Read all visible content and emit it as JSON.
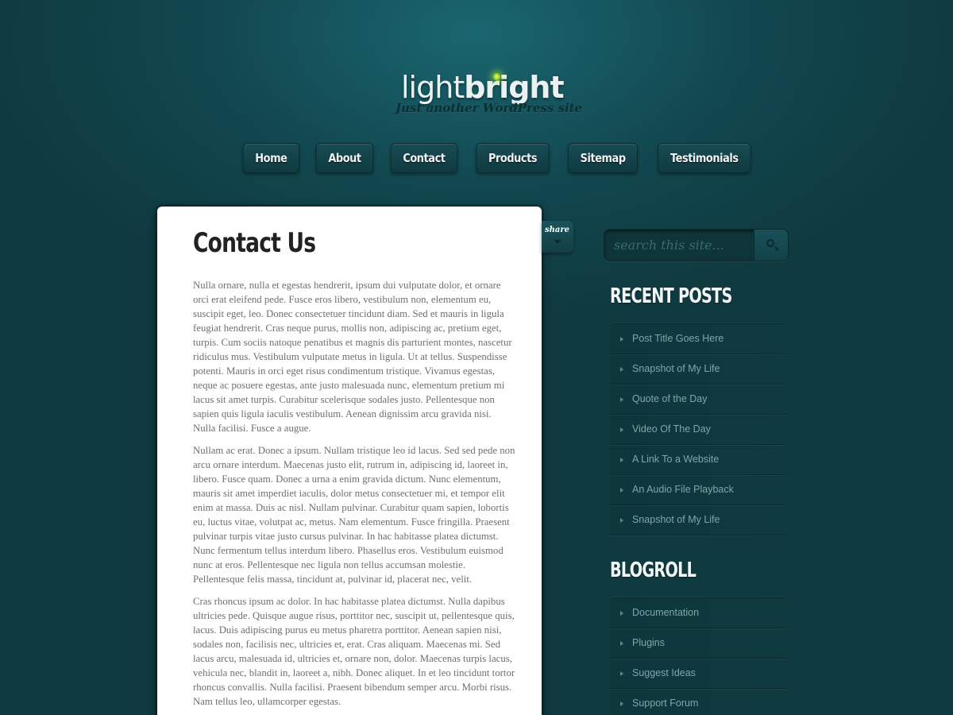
{
  "site": {
    "logo_light": "light",
    "logo_bright": "bright",
    "tagline": "Just another WordPress site"
  },
  "nav": [
    {
      "label": "Home"
    },
    {
      "label": "About"
    },
    {
      "label": "Contact"
    },
    {
      "label": "Products"
    },
    {
      "label": "Sitemap"
    },
    {
      "label": "Testimonials"
    }
  ],
  "page": {
    "title": "Contact Us",
    "paragraphs": [
      "Nulla ornare, nulla et egestas hendrerit, ipsum dui vulputate dolor, et ornare orci erat eleifend pede. Fusce eros libero, vestibulum non, elementum eu, suscipit eget, leo. Donec consectetuer tincidunt diam. Sed et mauris in ligula feugiat hendrerit. Cras neque purus, mollis non, adipiscing ac, pretium eget, turpis. Cum sociis natoque penatibus et magnis dis parturient montes, nascetur ridiculus mus. Vestibulum vulputate metus in ligula. Ut at tellus. Suspendisse potenti. Mauris in orci eget risus condimentum tristique. Vivamus egestas, neque ac posuere egestas, ante justo malesuada nunc, elementum pretium mi lacus sit amet turpis. Curabitur scelerisque sodales justo. Pellentesque non sapien quis ligula iaculis vestibulum. Aenean dignissim arcu gravida nisi. Nulla facilisi. Fusce a augue.",
      "Nullam ac erat. Donec a ipsum. Nullam tristique leo id lacus. Sed sed pede non arcu ornare interdum. Maecenas justo elit, rutrum in, adipiscing id, laoreet in, libero. Fusce quam. Donec a urna a enim gravida dictum. Nunc elementum, mauris sit amet imperdiet iaculis, dolor metus consectetuer mi, et tempor elit enim at massa. Duis ac nisl. Nullam pulvinar. Curabitur quam sapien, lobortis eu, luctus vitae, volutpat ac, metus. Nam elementum. Fusce fringilla. Praesent pulvinar turpis vitae justo cursus pulvinar. In hac habitasse platea dictumst. Nunc fermentum tellus interdum libero. Phasellus eros. Vestibulum euismod nunc at eros. Pellentesque nec ligula non tellus accumsan molestie. Pellentesque felis massa, tincidunt at, pulvinar id, placerat nec, velit.",
      "Cras rhoncus ipsum ac dolor. In hac habitasse platea dictumst. Nulla dapibus ultricies pede. Quisque augue risus, porttitor nec, suscipit ut, pellentesque quis, lacus. Duis adipiscing purus eu metus pharetra porttitor. Aenean sapien nisi, sodales non, facilisis nec, ultricies et, erat. Cras aliquam. Maecenas mi. Sed lacus arcu, malesuada id, ultricies et, ornare non, dolor. Maecenas turpis lacus, vehicula nec, blandit in, laoreet a, nibh. Donec aliquet. In et leo tincidunt tortor rhoncus convallis. Nulla facilisi. Praesent bibendum semper arcu. Morbi risus. Nam tellus leo, ullamcorper egestas."
    ]
  },
  "share": {
    "label": "share"
  },
  "search": {
    "placeholder": "search this site..."
  },
  "recent_posts": {
    "title": "RECENT POSTS",
    "items": [
      {
        "label": "Post Title Goes Here"
      },
      {
        "label": "Snapshot of My Life"
      },
      {
        "label": "Quote of the Day"
      },
      {
        "label": "Video Of The Day"
      },
      {
        "label": "A Link To a Website"
      },
      {
        "label": "An Audio File Playback"
      },
      {
        "label": "Snapshot of My Life"
      }
    ]
  },
  "blogroll": {
    "title": "BLOGROLL",
    "items": [
      {
        "label": "Documentation"
      },
      {
        "label": "Plugins"
      },
      {
        "label": "Suggest Ideas"
      },
      {
        "label": "Support Forum"
      }
    ]
  },
  "colors": {
    "background": "#12474f",
    "accent_dot": "#9ed11f",
    "card": "#ffffff",
    "sidebar_link": "#7fa6aa"
  }
}
